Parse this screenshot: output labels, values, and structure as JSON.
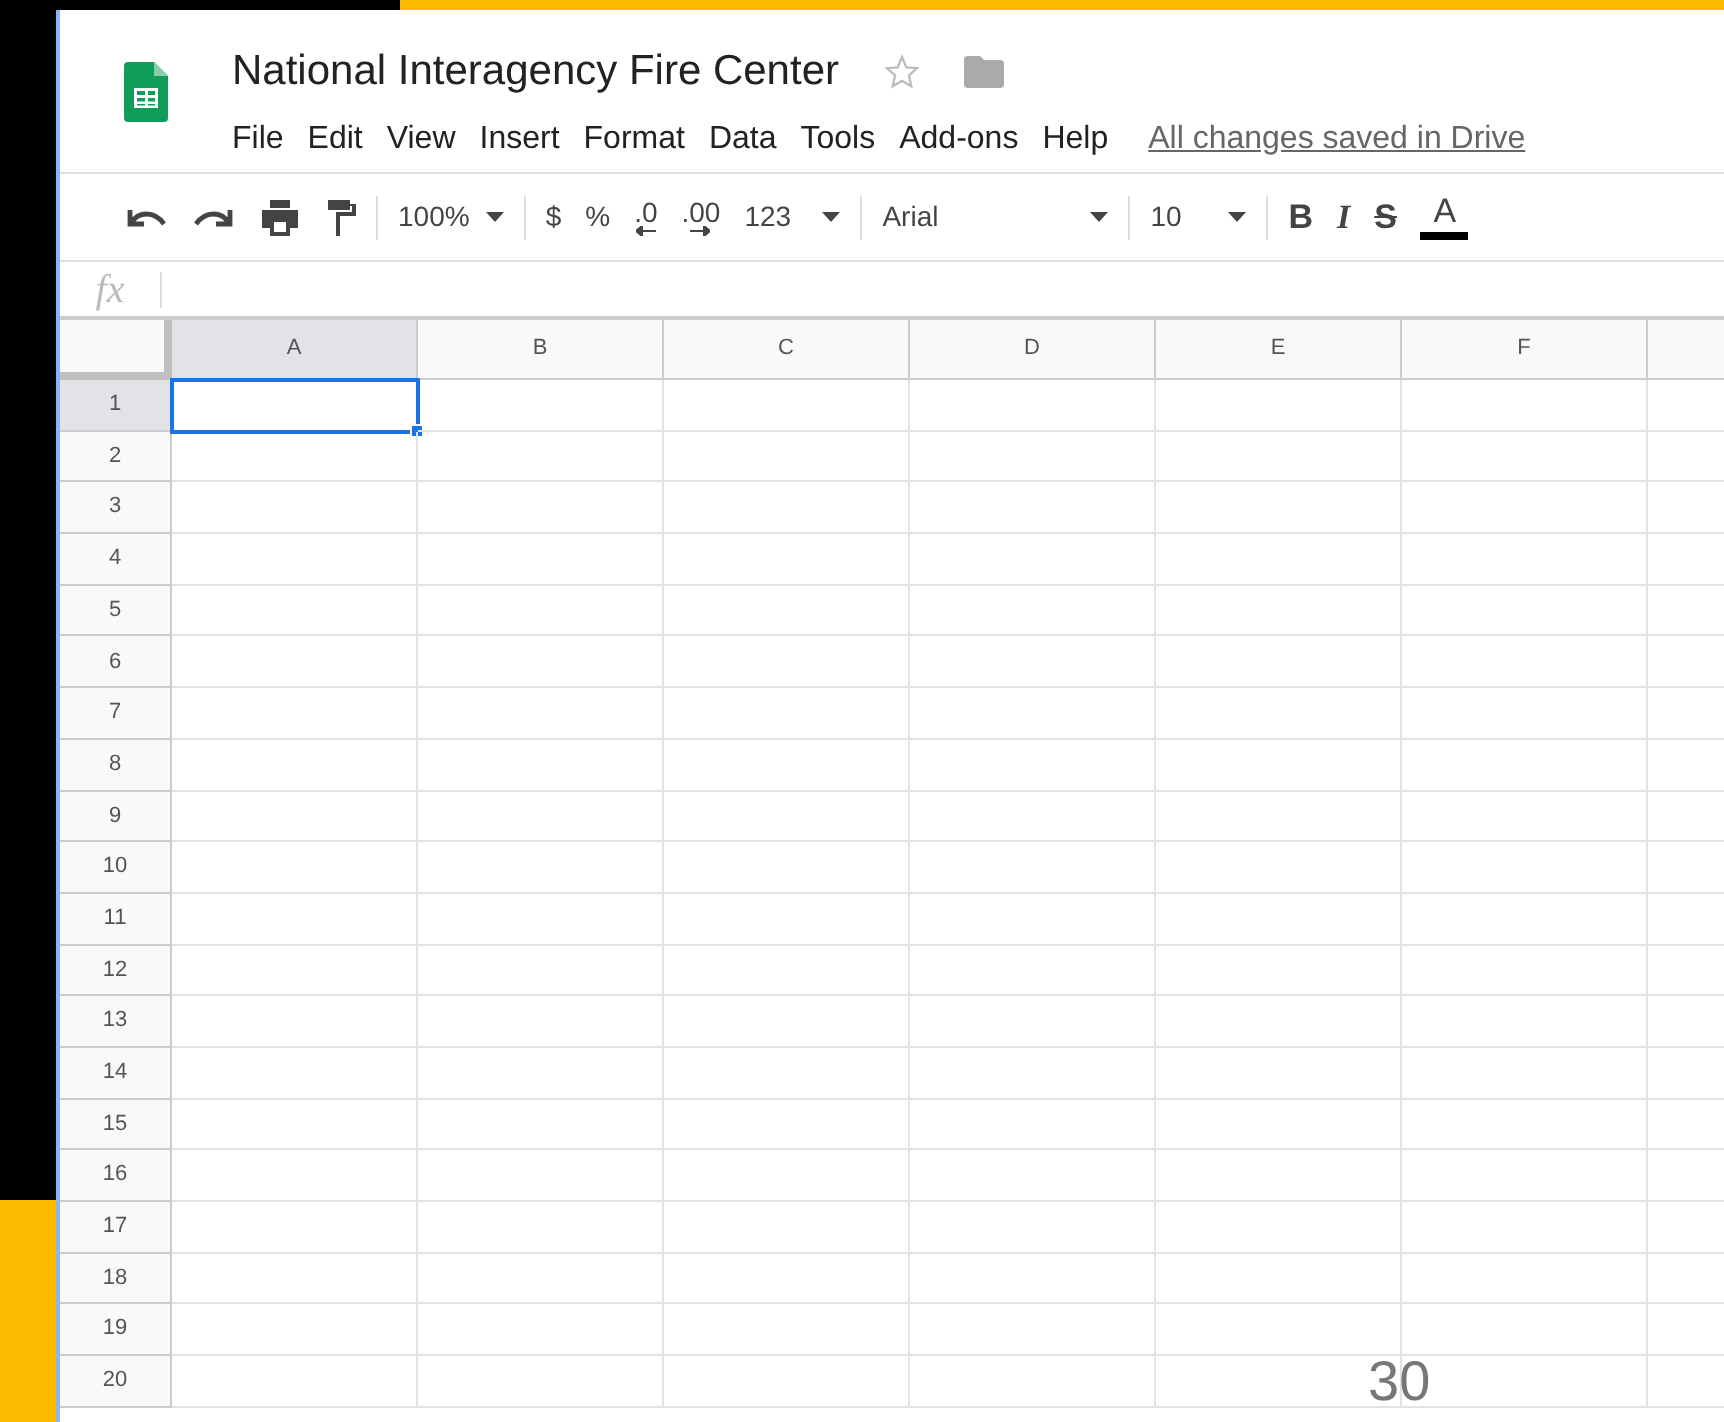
{
  "document": {
    "title": "National Interagency Fire Center",
    "starred": false
  },
  "menu": [
    "File",
    "Edit",
    "View",
    "Insert",
    "Format",
    "Data",
    "Tools",
    "Add-ons",
    "Help"
  ],
  "save_status": "All changes saved in Drive",
  "toolbar": [
    [
      {
        "kind": "undo"
      },
      {
        "kind": "redo"
      },
      {
        "kind": "print"
      },
      {
        "kind": "paint-format"
      }
    ],
    [
      {
        "kind": "dropdown",
        "label": "100%"
      }
    ],
    [
      {
        "kind": "text",
        "label": "$"
      },
      {
        "kind": "text",
        "label": "%"
      },
      {
        "kind": "decimal-decrease",
        "label": ".0"
      },
      {
        "kind": "decimal-increase",
        "label": ".00"
      },
      {
        "kind": "dropdown",
        "label": "123"
      }
    ],
    [
      {
        "kind": "font-dropdown",
        "label": "Arial"
      }
    ],
    [
      {
        "kind": "dropdown",
        "label": "10"
      }
    ],
    [
      {
        "kind": "bold",
        "label": "B"
      },
      {
        "kind": "italic",
        "label": "I"
      },
      {
        "kind": "strike",
        "label": "S"
      },
      {
        "kind": "text-color",
        "label": "A"
      }
    ]
  ],
  "formula_bar": {
    "label": "fx"
  },
  "columns": [
    {
      "label": "A",
      "selected": true
    },
    {
      "label": "B",
      "selected": false
    },
    {
      "label": "C",
      "selected": false
    },
    {
      "label": "D",
      "selected": false
    },
    {
      "label": "E",
      "selected": false
    },
    {
      "label": "F",
      "selected": false
    }
  ],
  "rows": [
    {
      "label": "1",
      "selected": true
    },
    {
      "label": "2",
      "selected": false
    },
    {
      "label": "3",
      "selected": false
    },
    {
      "label": "4",
      "selected": false
    },
    {
      "label": "5",
      "selected": false
    },
    {
      "label": "6",
      "selected": false
    },
    {
      "label": "7",
      "selected": false
    },
    {
      "label": "8",
      "selected": false
    },
    {
      "label": "9",
      "selected": false
    },
    {
      "label": "10",
      "selected": false
    },
    {
      "label": "11",
      "selected": false
    },
    {
      "label": "12",
      "selected": false
    },
    {
      "label": "13",
      "selected": false
    },
    {
      "label": "14",
      "selected": false
    },
    {
      "label": "15",
      "selected": false
    },
    {
      "label": "16",
      "selected": false
    },
    {
      "label": "17",
      "selected": false
    },
    {
      "label": "18",
      "selected": false
    },
    {
      "label": "19",
      "selected": false
    },
    {
      "label": "20",
      "selected": false
    }
  ],
  "slide_number": "30"
}
